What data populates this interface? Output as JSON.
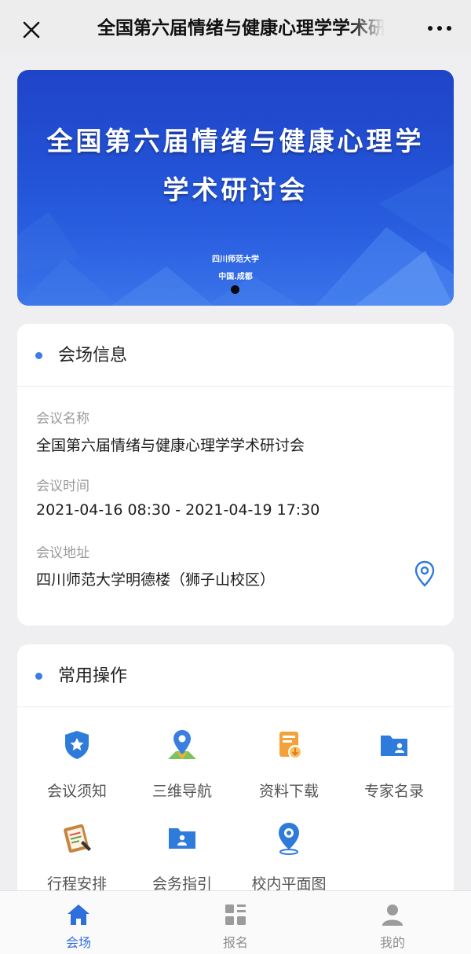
{
  "window": {
    "title": "全国第六届情绪与健康心理学学术研讨会"
  },
  "banner": {
    "title_line1": "全国第六届情绪与健康心理学",
    "title_line2": "学术研讨会",
    "host": "四川师范大学",
    "location": "中国.成都",
    "slide_count": 1,
    "active_slide": 1
  },
  "venue": {
    "heading": "会场信息",
    "name_label": "会议名称",
    "name_value": "全国第六届情绪与健康心理学学术研讨会",
    "time_label": "会议时间",
    "time_value": "2021-04-16 08:30 - 2021-04-19 17:30",
    "address_label": "会议地址",
    "address_value": "四川师范大学明德楼（狮子山校区）"
  },
  "ops": {
    "heading": "常用操作",
    "items": [
      {
        "label": "会议须知",
        "icon": "shield-star-icon"
      },
      {
        "label": "三维导航",
        "icon": "map-pin-icon"
      },
      {
        "label": "资料下载",
        "icon": "document-download-icon"
      },
      {
        "label": "专家名录",
        "icon": "folder-user-icon"
      },
      {
        "label": "行程安排",
        "icon": "clipboard-icon"
      },
      {
        "label": "会务指引",
        "icon": "folder-guide-icon"
      },
      {
        "label": "校内平面图",
        "icon": "location-icon"
      }
    ]
  },
  "tabs": [
    {
      "label": "会场",
      "icon": "home-icon",
      "active": true
    },
    {
      "label": "报名",
      "icon": "grid-icon",
      "active": false
    },
    {
      "label": "我的",
      "icon": "user-icon",
      "active": false
    }
  ],
  "colors": {
    "accent": "#3a7be6",
    "active_tab": "#2f6fdc",
    "banner_blue": "#2353d6"
  }
}
